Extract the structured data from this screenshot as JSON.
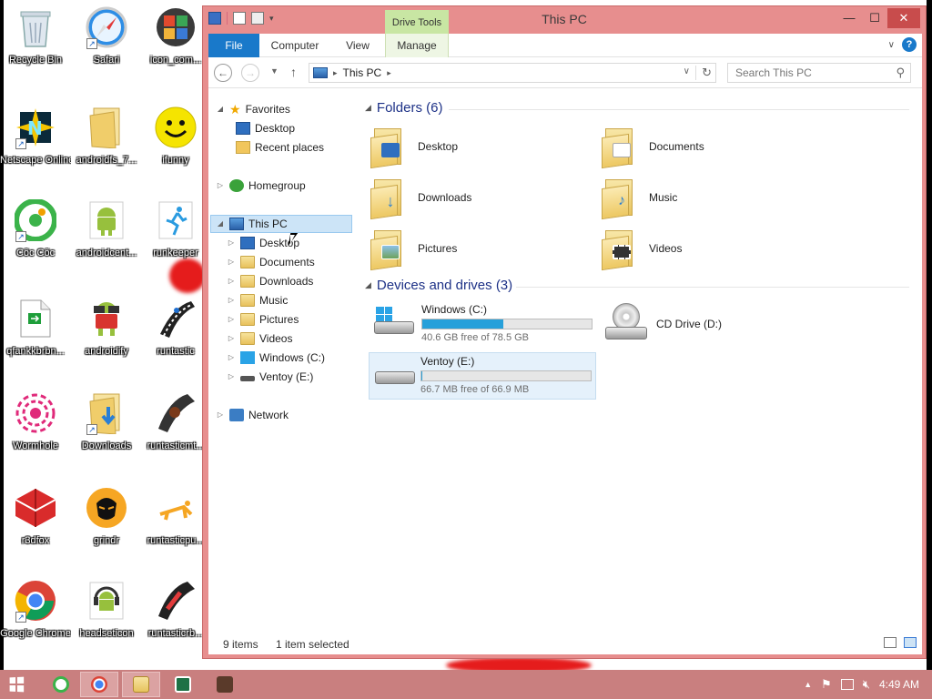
{
  "desktop": {
    "icons": [
      {
        "label": "Recycle Bin",
        "icon": "recycle-bin-icon"
      },
      {
        "label": "Safari",
        "icon": "safari-icon"
      },
      {
        "label": "icon_com...",
        "icon": "app-grid-icon"
      },
      {
        "label": "Netscape Online",
        "icon": "netscape-icon"
      },
      {
        "label": "androidfs_7...",
        "icon": "folder-icon"
      },
      {
        "label": "ifunny",
        "icon": "smiley-icon"
      },
      {
        "label": "Cốc Cốc",
        "icon": "coccoc-icon"
      },
      {
        "label": "androidcent...",
        "icon": "android-icon"
      },
      {
        "label": "runkeeper",
        "icon": "runner-icon"
      },
      {
        "label": "qfankkbrbn...",
        "icon": "document-icon"
      },
      {
        "label": "androidify",
        "icon": "android-glasses-icon"
      },
      {
        "label": "runtastic",
        "icon": "runtastic-icon"
      },
      {
        "label": "Wormhole",
        "icon": "wormhole-icon"
      },
      {
        "label": "Downloads",
        "icon": "downloads-folder-icon"
      },
      {
        "label": "runtasticmt...",
        "icon": "runtastic-mt-icon"
      },
      {
        "label": "r3dfox",
        "icon": "r3dfox-icon"
      },
      {
        "label": "grindr",
        "icon": "grindr-icon"
      },
      {
        "label": "runtasticpu...",
        "icon": "runtastic-pushups-icon"
      },
      {
        "label": "Google Chrome",
        "icon": "chrome-icon"
      },
      {
        "label": "headseticon",
        "icon": "headset-android-icon"
      },
      {
        "label": "runtasticrb...",
        "icon": "runtastic-rb-icon"
      }
    ]
  },
  "window": {
    "title": "This PC",
    "context_tab": "Drive Tools",
    "ribbon_tabs": [
      "File",
      "Computer",
      "View",
      "Manage"
    ],
    "address": "This PC",
    "search_placeholder": "Search This PC",
    "nav": {
      "favorites": "Favorites",
      "desktop": "Desktop",
      "recent": "Recent places",
      "homegroup": "Homegroup",
      "thispc": "This PC",
      "pc_children": [
        "Desktop",
        "Documents",
        "Downloads",
        "Music",
        "Pictures",
        "Videos",
        "Windows (C:)",
        "Ventoy (E:)"
      ],
      "network": "Network"
    },
    "folders_header": "Folders (6)",
    "folders": [
      "Desktop",
      "Documents",
      "Downloads",
      "Music",
      "Pictures",
      "Videos"
    ],
    "devices_header": "Devices and drives (3)",
    "drives": [
      {
        "name": "Windows (C:)",
        "free": "40.6 GB free of 78.5 GB",
        "used_fraction": 0.48
      },
      {
        "name": "CD Drive (D:)"
      },
      {
        "name": "Ventoy (E:)",
        "free": "66.7 MB free of 66.9 MB",
        "used_fraction": 0.003
      }
    ],
    "status_items": "9 items",
    "status_selected": "1 item selected"
  },
  "taskbar": {
    "time": "4:49 AM"
  },
  "colors": {
    "window_frame": "#e78e8e",
    "accent_blue": "#1979ca",
    "taskbar": "#c97f7f",
    "bar_fill": "#26a0da"
  }
}
